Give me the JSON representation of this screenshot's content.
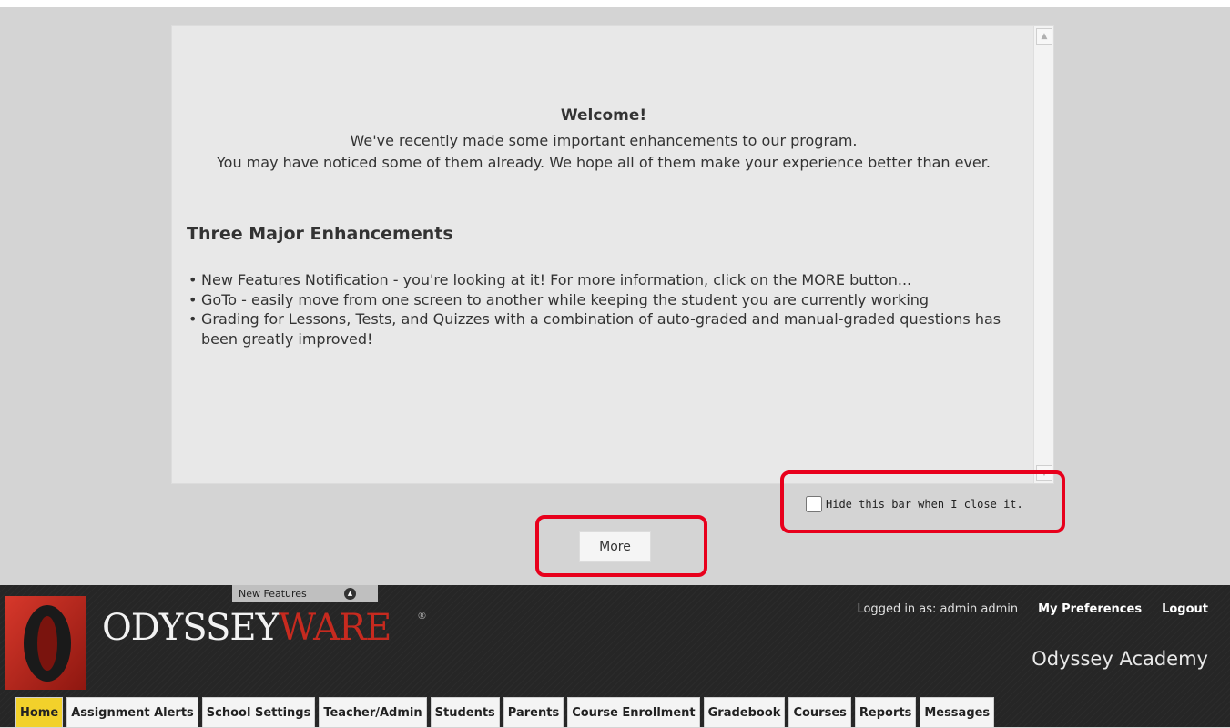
{
  "dialog": {
    "welcome_title": "Welcome!",
    "intro_line1": "We've recently made some important enhancements to our program.",
    "intro_line2": "You may have noticed some of them already. We hope all of them make your experience better than ever.",
    "enhancements_heading": "Three Major Enhancements",
    "enhancements": [
      "New Features Notification - you're looking at it! For more information, click on the MORE button...",
      "GoTo - easily move from one screen to another while keeping the student you are currently working",
      "Grading for Lessons, Tests, and Quizzes with a combination of auto-graded and manual-graded questions has been greatly improved!"
    ],
    "hide_bar_label": "Hide this bar when I close it.",
    "hide_bar_checked": false,
    "more_button_label": "More"
  },
  "new_features_tab": {
    "label": "New Features",
    "toggle_icon": "chevron-up-icon"
  },
  "header": {
    "logo_primary": "ODYSSEY",
    "logo_accent": "WARE",
    "logo_trademark": "®",
    "logged_in_text": "Logged in as: admin admin",
    "preferences_label": "My Preferences",
    "logout_label": "Logout",
    "school_name": "Odyssey Academy"
  },
  "nav_tabs": [
    {
      "label": "Home",
      "active": true
    },
    {
      "label": "Assignment Alerts",
      "active": false
    },
    {
      "label": "School Settings",
      "active": false
    },
    {
      "label": "Teacher/Admin",
      "active": false
    },
    {
      "label": "Students",
      "active": false
    },
    {
      "label": "Parents",
      "active": false
    },
    {
      "label": "Course Enrollment",
      "active": false
    },
    {
      "label": "Gradebook",
      "active": false
    },
    {
      "label": "Courses",
      "active": false
    },
    {
      "label": "Reports",
      "active": false
    },
    {
      "label": "Messages",
      "active": false
    }
  ],
  "colors": {
    "annotation": "#e8001c",
    "active_tab": "#f2d12b",
    "brand_red": "#c72a1f",
    "header_bg": "#262626",
    "page_bg": "#d4d4d4"
  }
}
